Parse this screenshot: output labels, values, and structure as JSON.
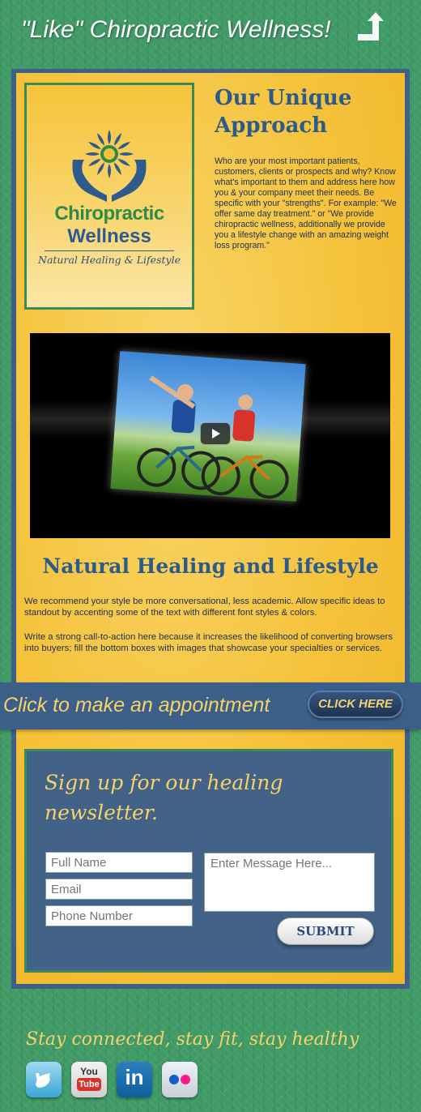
{
  "like_banner": {
    "text": "\"Like\" Chiropractic Wellness!",
    "icon": "share-arrow-icon"
  },
  "logo": {
    "name_line1": "Chiropractic",
    "name_line2": "Wellness",
    "tagline": "Natural Healing & Lifestyle"
  },
  "approach": {
    "title": "Our Unique Approach",
    "body": "Who are your most important patients, customers, clients or prospects and why? Know what's important to them and address here how you & your company meet their needs. Be specific with your \"strengths\". For example: \"We offer same day treatment.\" or \"We provide chiropractic wellness, additionally we provide you a lifestyle change with an amazing weight loss program.\""
  },
  "video": {
    "icon": "play-icon"
  },
  "healing": {
    "title": "Natural Healing and Lifestyle",
    "paragraph1": "We recommend your style be more conversational, less academic. Allow specific ideas to standout by accenting some of the text with different font styles & colors.",
    "paragraph2": "Write a strong call-to-action here because it increases the likelihood of converting browsers into buyers; fill the bottom boxes with images that showcase your specialties or services."
  },
  "appointment": {
    "text": "Click to make an appointment",
    "button_label": "CLICK HERE"
  },
  "newsletter": {
    "title": "Sign up for our healing newsletter.",
    "full_name_placeholder": "Full Name",
    "email_placeholder": "Email",
    "phone_placeholder": "Phone Number",
    "message_placeholder": "Enter Message Here...",
    "submit_label": "SUBMIT"
  },
  "footer": {
    "tagline": "Stay connected, stay fit, stay healthy",
    "social": [
      "twitter-icon",
      "youtube-icon",
      "linkedin-icon",
      "flickr-icon"
    ],
    "youtube_text_top": "You",
    "youtube_text_bottom": "Tube",
    "linkedin_text": "in"
  },
  "colors": {
    "green": "#3f9a66",
    "navy": "#3d5f88",
    "gold": "#f6d26a",
    "yellow": "#f5c23a"
  }
}
